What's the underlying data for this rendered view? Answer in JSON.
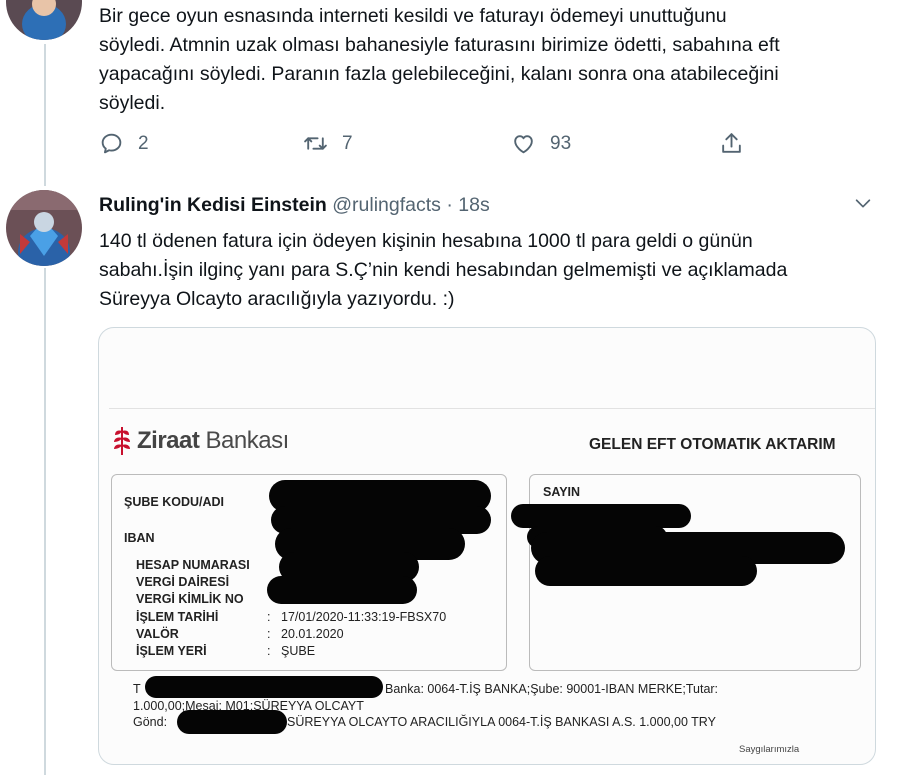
{
  "tweet1": {
    "text_lines": [
      "Bir gece oyun esnasında interneti kesildi ve faturayı ödemeyi unuttuğunu",
      "söyledi. Atmnin uzak olması bahanesiyle faturasını birimize ödetti, sabahına eft",
      "yapacağını söyledi. Paranın fazla gelebileceğini, kalanı sonra ona atabileceğini",
      "söyledi."
    ],
    "replies": "2",
    "retweets": "7",
    "likes": "93"
  },
  "tweet2": {
    "display_name": "Ruling'in Kedisi Einstein",
    "handle": "@rulingfacts",
    "separator": " · ",
    "time": "18s",
    "text_lines": [
      "140 tl ödenen fatura için ödeyen kişinin hesabına 1000 tl para geldi o günün",
      "sabahı.İşin ilginç yanı para S.Ç’nin kendi hesabından gelmemişti ve açıklamada",
      "Süreyya Olcayto aracılığıyla yazıyordu. :)"
    ]
  },
  "receipt": {
    "bank_name_bold": "Ziraat",
    "bank_name_rest": " Bankası",
    "title": "GELEN EFT OTOMATIK AKTARIM",
    "labels": {
      "sube": "ŞUBE KODU/ADI",
      "iban": "IBAN",
      "hesap": "HESAP NUMARASI",
      "vergi_dairesi": "VERGİ DAİRESİ",
      "vergi_kimlik": "VERGİ KİMLİK NO",
      "islem_tarihi": "İŞLEM TARİHİ",
      "valor": "VALÖR",
      "islem_yeri": "İŞLEM YERİ",
      "sayin": "SAYIN"
    },
    "values": {
      "islem_tarihi": "17/01/2020-11:33:19-FBSX70",
      "valor": "20.01.2020",
      "islem_yeri": "ŞUBE"
    },
    "footer": {
      "line1_prefix": "T",
      "line1": "Banka: 0064-T.İŞ BANKA;Şube: 90001-IBAN MERKE;Tutar:",
      "line2": "1.000,00;Mesaj: M01;SÜREYYA OLCAYT",
      "line3_prefix": "Gönd:",
      "line3": "SÜREYYA OLCAYTO ARACILIĞIYLA 0064-T.İŞ BANKASI A.S. 1.000,00 TRY"
    },
    "signature": "Saygılarımızla"
  },
  "colors": {
    "text": "#0f1419",
    "secondary": "#536471",
    "border": "#cfd9de",
    "ziraat_red": "#c8102e"
  },
  "icons": [
    "reply-icon",
    "retweet-icon",
    "like-icon",
    "share-icon",
    "chevron-down-icon",
    "ziraat-logo-icon"
  ]
}
